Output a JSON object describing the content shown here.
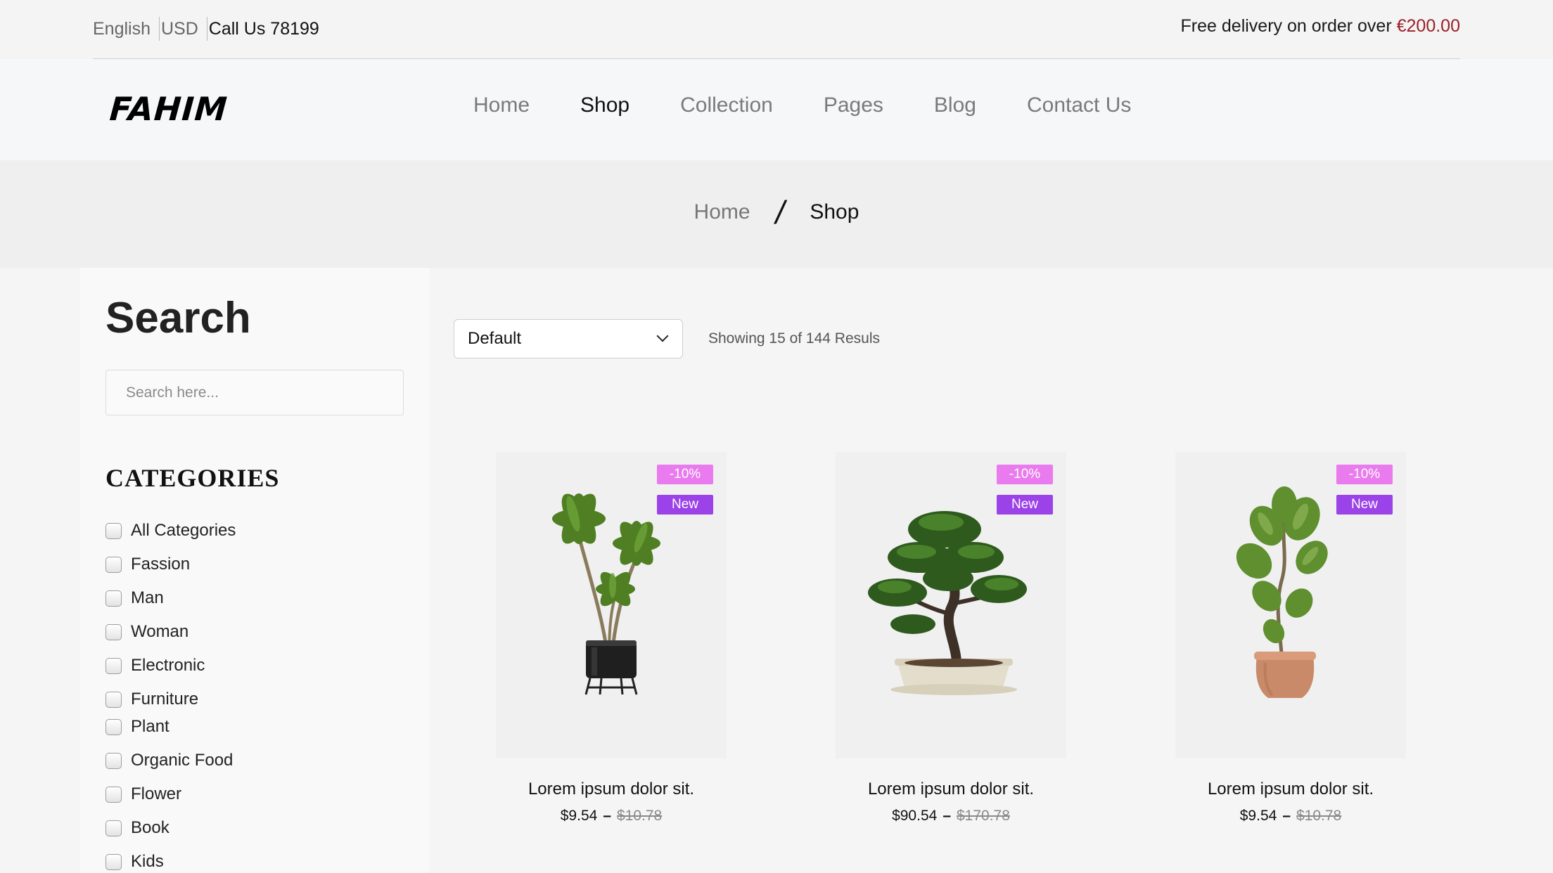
{
  "topbar": {
    "language": "English",
    "currency": "USD",
    "call": "Call Us 78199",
    "delivery_text": "Free delivery on order over ",
    "delivery_amount": "€200.00"
  },
  "header": {
    "logo": "FAHIM",
    "nav": [
      {
        "label": "Home",
        "active": false
      },
      {
        "label": "Shop",
        "active": true
      },
      {
        "label": "Collection",
        "active": false
      },
      {
        "label": "Pages",
        "active": false
      },
      {
        "label": "Blog",
        "active": false
      },
      {
        "label": "Contact Us",
        "active": false
      }
    ]
  },
  "breadcrumb": {
    "home": "Home",
    "separator": "/",
    "current": "Shop"
  },
  "sidebar": {
    "title": "Search",
    "search_placeholder": "Search here...",
    "categories_title": "CATEGORIES",
    "categories": [
      "All Categories",
      "Fassion",
      "Man",
      "Woman",
      "Electronic",
      "Furniture",
      "Plant",
      "Organic Food",
      "Flower",
      "Book",
      "Kids"
    ]
  },
  "toolbar": {
    "sort_value": "Default",
    "results_text": "Showing 15 of 144 Resuls"
  },
  "products": [
    {
      "discount": "-10%",
      "badge": "New",
      "title": "Lorem ipsum dolor sit.",
      "price": "$9.54",
      "old_price": "$10.78",
      "image": "potted-dracaena-plant"
    },
    {
      "discount": "-10%",
      "badge": "New",
      "title": "Lorem ipsum dolor sit.",
      "price": "$90.54",
      "old_price": "$170.78",
      "image": "bonsai-tree"
    },
    {
      "discount": "-10%",
      "badge": "New",
      "title": "Lorem ipsum dolor sit.",
      "price": "$9.54",
      "old_price": "$10.78",
      "image": "fiddle-leaf-fig-plant"
    }
  ],
  "colors": {
    "discount_badge": "#e97bee",
    "new_badge": "#9b42e8",
    "delivery_amount": "#9b1f28"
  }
}
